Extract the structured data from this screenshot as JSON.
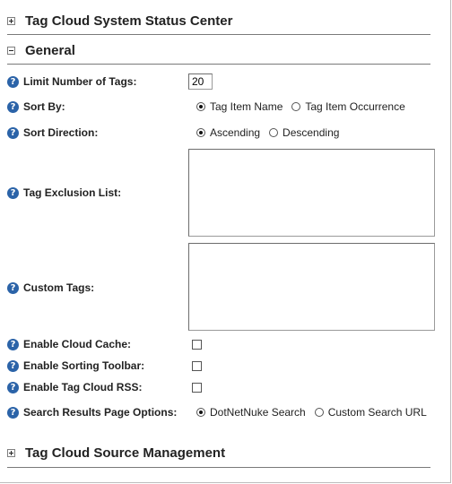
{
  "sections": {
    "status_title": "Tag Cloud System Status Center",
    "general_title": "General",
    "source_title": "Tag Cloud Source Management"
  },
  "fields": {
    "limit": {
      "label": "Limit Number of Tags:",
      "value": "20"
    },
    "sort_by": {
      "label": "Sort By:",
      "options": [
        "Tag Item Name",
        "Tag Item Occurrence"
      ],
      "selected": "Tag Item Name"
    },
    "sort_direction": {
      "label": "Sort Direction:",
      "options": [
        "Ascending",
        "Descending"
      ],
      "selected": "Ascending"
    },
    "exclusion": {
      "label": "Tag Exclusion List:"
    },
    "custom_tags": {
      "label": "Custom Tags:"
    },
    "cloud_cache": {
      "label": "Enable Cloud Cache:",
      "checked": false
    },
    "sorting_toolbar": {
      "label": "Enable Sorting Toolbar:",
      "checked": false
    },
    "rss": {
      "label": "Enable Tag Cloud RSS:",
      "checked": false
    },
    "search_options": {
      "label": "Search Results Page Options:",
      "options": [
        "DotNetNuke Search",
        "Custom Search URL"
      ],
      "selected": "DotNetNuke Search"
    }
  },
  "icons": {
    "help": "help-icon",
    "expand": "expand-icon",
    "collapse": "collapse-icon"
  },
  "colors": {
    "help_icon": "#2b63a8",
    "rule": "#7a7a7a"
  }
}
